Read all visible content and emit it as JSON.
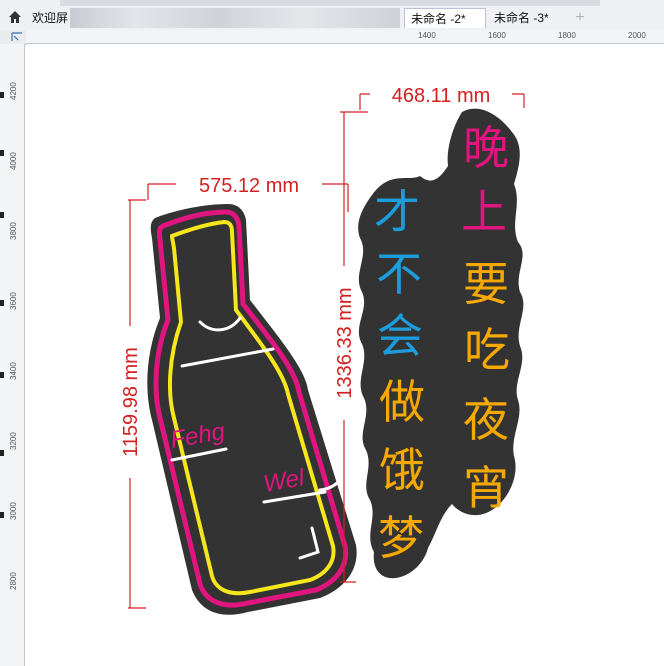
{
  "tabs": {
    "welcome": "欢迎屏",
    "doc2": "未命名 -2*",
    "doc3": "未命名 -3*",
    "add": "+"
  },
  "ruler": {
    "h_ticks": [
      "1400",
      "1600",
      "1800",
      "2000"
    ],
    "v_ticks": [
      "4200",
      "4000",
      "3800",
      "3600",
      "3400",
      "3200",
      "3000",
      "2800"
    ]
  },
  "dimensions": {
    "bottle_width": "575.12 mm",
    "bottle_height": "1159.98 mm",
    "text_width": "468.11 mm",
    "text_height": "1336.33 mm"
  },
  "bottle_text": {
    "line1": "Fehg",
    "line2": "Wel"
  },
  "phrase_blue": [
    "才",
    "不",
    "会"
  ],
  "phrase_orange_left": [
    "做",
    "饿",
    "梦"
  ],
  "phrase_pink": [
    "晚",
    "上"
  ],
  "phrase_orange_right": [
    "要",
    "吃",
    "夜",
    "宵"
  ],
  "colors": {
    "neon_pink": "#e0157f",
    "neon_yellow": "#f6e61c",
    "neon_orange": "#f5a800",
    "neon_blue": "#1d9ddb",
    "neon_white": "#ffffff",
    "board": "#333333",
    "dimension": "#d42020"
  }
}
